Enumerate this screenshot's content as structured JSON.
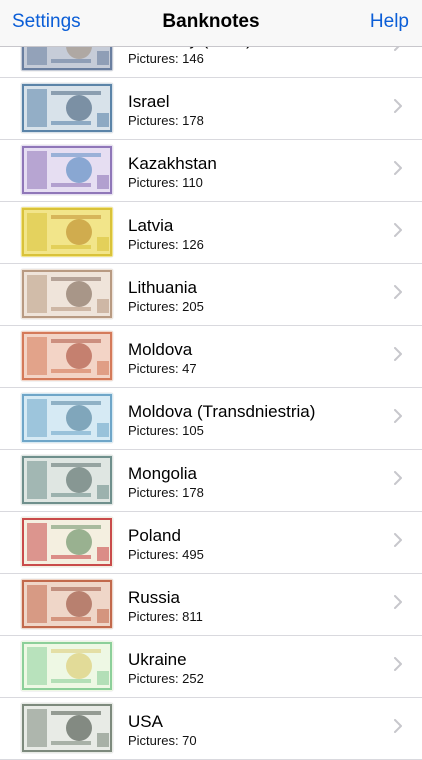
{
  "nav": {
    "left_label": "Settings",
    "title": "Banknotes",
    "right_label": "Help"
  },
  "countries": [
    {
      "name": "Germany (GDR)",
      "pictures": "Pictures: 146",
      "colors": [
        "#6a7fa0",
        "#c6ccd8",
        "#9d8a78"
      ]
    },
    {
      "name": "Israel",
      "pictures": "Pictures: 178",
      "colors": [
        "#5b84a8",
        "#d8e2ea",
        "#2f4c6a"
      ]
    },
    {
      "name": "Kazakhstan",
      "pictures": "Pictures: 110",
      "colors": [
        "#8f77b8",
        "#e6def2",
        "#3d7ab8"
      ]
    },
    {
      "name": "Latvia",
      "pictures": "Pictures: 126",
      "colors": [
        "#d9c23a",
        "#f2e58a",
        "#b57d1e"
      ]
    },
    {
      "name": "Lithuania",
      "pictures": "Pictures: 205",
      "colors": [
        "#b89a82",
        "#efe4da",
        "#6e5546"
      ]
    },
    {
      "name": "Moldova",
      "pictures": "Pictures: 47",
      "colors": [
        "#d47a5a",
        "#f3d4c6",
        "#9e3b28"
      ]
    },
    {
      "name": "Moldova (Transdniestria)",
      "pictures": "Pictures: 105",
      "colors": [
        "#6fa6c8",
        "#d6eaf4",
        "#3a6d8c"
      ]
    },
    {
      "name": "Mongolia",
      "pictures": "Pictures: 178",
      "colors": [
        "#6f8f8c",
        "#dfe6e2",
        "#3e5552"
      ]
    },
    {
      "name": "Poland",
      "pictures": "Pictures: 495",
      "colors": [
        "#c94b4b",
        "#f4efe0",
        "#4e7d4e"
      ]
    },
    {
      "name": "Russia",
      "pictures": "Pictures: 811",
      "colors": [
        "#c2694c",
        "#efd6c8",
        "#8a3a26"
      ]
    },
    {
      "name": "Ukraine",
      "pictures": "Pictures: 252",
      "colors": [
        "#8ccf9a",
        "#eef8e4",
        "#d8c25a"
      ]
    },
    {
      "name": "USA",
      "pictures": "Pictures: 70",
      "colors": [
        "#7d8a7d",
        "#e8ebe6",
        "#2f3a2f"
      ]
    }
  ]
}
